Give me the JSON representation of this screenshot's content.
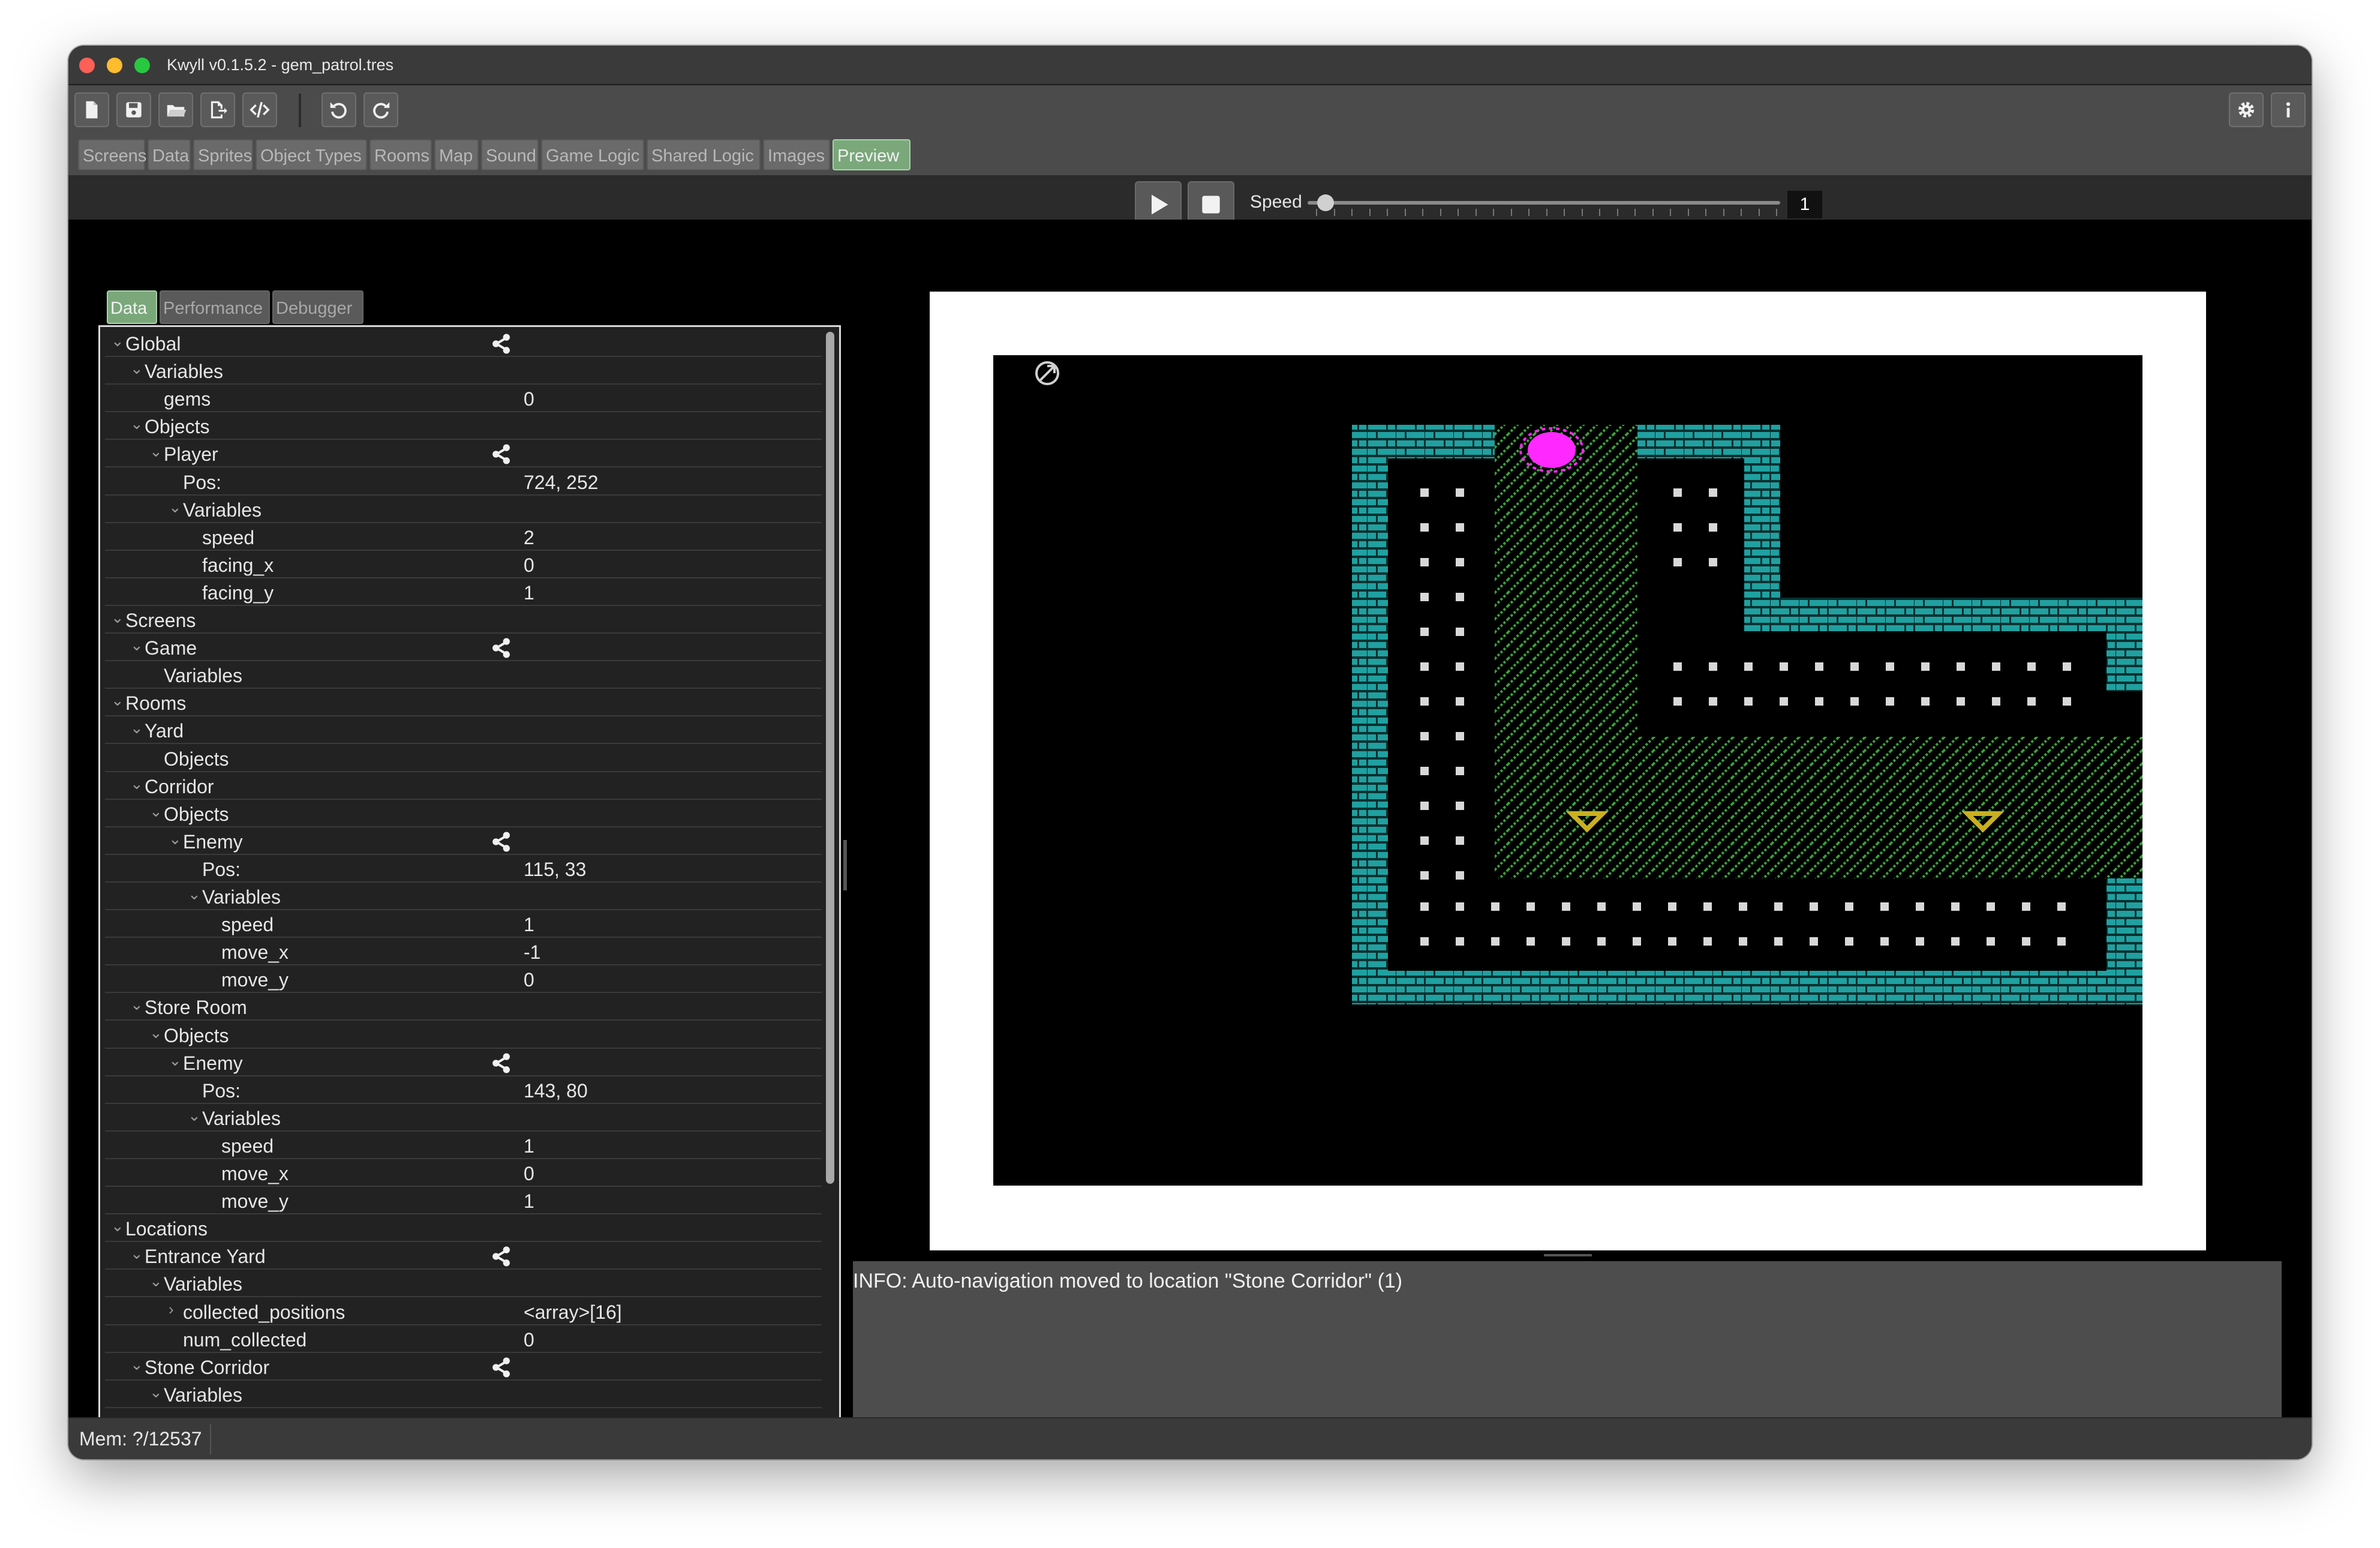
{
  "window": {
    "title": "Kwyll v0.1.5.2 - gem_patrol.tres"
  },
  "toolbar": {
    "buttons": [
      "new-file-icon",
      "save-icon",
      "open-folder-icon",
      "export-icon",
      "code-icon",
      "undo-icon",
      "redo-icon"
    ],
    "right_buttons": [
      "gear-icon",
      "info-icon"
    ]
  },
  "tabs": [
    "Screens",
    "Data",
    "Sprites",
    "Object Types",
    "Rooms",
    "Map",
    "Sound",
    "Game Logic",
    "Shared Logic",
    "Images",
    "Preview"
  ],
  "active_tab": "Preview",
  "run": {
    "speed_label": "Speed",
    "speed_value": "1"
  },
  "subtabs": [
    "Data",
    "Performance",
    "Debugger"
  ],
  "active_subtab": "Data",
  "tree": [
    {
      "label": "Global",
      "depth": 0,
      "expanded": true,
      "share": true
    },
    {
      "label": "Variables",
      "depth": 1,
      "expanded": true
    },
    {
      "label": "gems",
      "depth": 2,
      "value": "0"
    },
    {
      "label": "Objects",
      "depth": 1,
      "expanded": true
    },
    {
      "label": "Player",
      "depth": 2,
      "expanded": true,
      "share": true
    },
    {
      "label": "Pos:",
      "depth": 3,
      "value": "724, 252"
    },
    {
      "label": "Variables",
      "depth": 3,
      "expanded": true
    },
    {
      "label": "speed",
      "depth": 4,
      "value": "2"
    },
    {
      "label": "facing_x",
      "depth": 4,
      "value": "0"
    },
    {
      "label": "facing_y",
      "depth": 4,
      "value": "1"
    },
    {
      "label": "Screens",
      "depth": 0,
      "expanded": true
    },
    {
      "label": "Game",
      "depth": 1,
      "expanded": true,
      "share": true
    },
    {
      "label": "Variables",
      "depth": 2
    },
    {
      "label": "Rooms",
      "depth": 0,
      "expanded": true
    },
    {
      "label": "Yard",
      "depth": 1,
      "expanded": true
    },
    {
      "label": "Objects",
      "depth": 2
    },
    {
      "label": "Corridor",
      "depth": 1,
      "expanded": true
    },
    {
      "label": "Objects",
      "depth": 2,
      "expanded": true
    },
    {
      "label": "Enemy",
      "depth": 3,
      "expanded": true,
      "share": true
    },
    {
      "label": "Pos:",
      "depth": 4,
      "value": "115, 33"
    },
    {
      "label": "Variables",
      "depth": 4,
      "expanded": true
    },
    {
      "label": "speed",
      "depth": 5,
      "value": "1"
    },
    {
      "label": "move_x",
      "depth": 5,
      "value": "-1"
    },
    {
      "label": "move_y",
      "depth": 5,
      "value": "0"
    },
    {
      "label": "Store Room",
      "depth": 1,
      "expanded": true
    },
    {
      "label": "Objects",
      "depth": 2,
      "expanded": true
    },
    {
      "label": "Enemy",
      "depth": 3,
      "expanded": true,
      "share": true
    },
    {
      "label": "Pos:",
      "depth": 4,
      "value": "143, 80"
    },
    {
      "label": "Variables",
      "depth": 4,
      "expanded": true
    },
    {
      "label": "speed",
      "depth": 5,
      "value": "1"
    },
    {
      "label": "move_x",
      "depth": 5,
      "value": "0"
    },
    {
      "label": "move_y",
      "depth": 5,
      "value": "1"
    },
    {
      "label": "Locations",
      "depth": 0,
      "expanded": true
    },
    {
      "label": "Entrance Yard",
      "depth": 1,
      "expanded": true,
      "share": true
    },
    {
      "label": "Variables",
      "depth": 2,
      "expanded": true
    },
    {
      "label": "collected_positions",
      "depth": 3,
      "collapsed": true,
      "value": "<array>[16]"
    },
    {
      "label": "num_collected",
      "depth": 3,
      "value": "0"
    },
    {
      "label": "Stone Corridor",
      "depth": 1,
      "expanded": true,
      "share": true
    },
    {
      "label": "Variables",
      "depth": 2,
      "expanded": true
    }
  ],
  "log": {
    "line": "INFO: Auto-navigation moved to location \"Stone Corridor\" (1)"
  },
  "status": {
    "mem": "Mem: ?/12537"
  },
  "colors": {
    "wall": "#20a0a0",
    "grass": "#3aa03a",
    "player": "#ff28ff",
    "gem": "#c8b020",
    "dot": "#d8d8d8",
    "tab_active": "#7aa87b"
  }
}
